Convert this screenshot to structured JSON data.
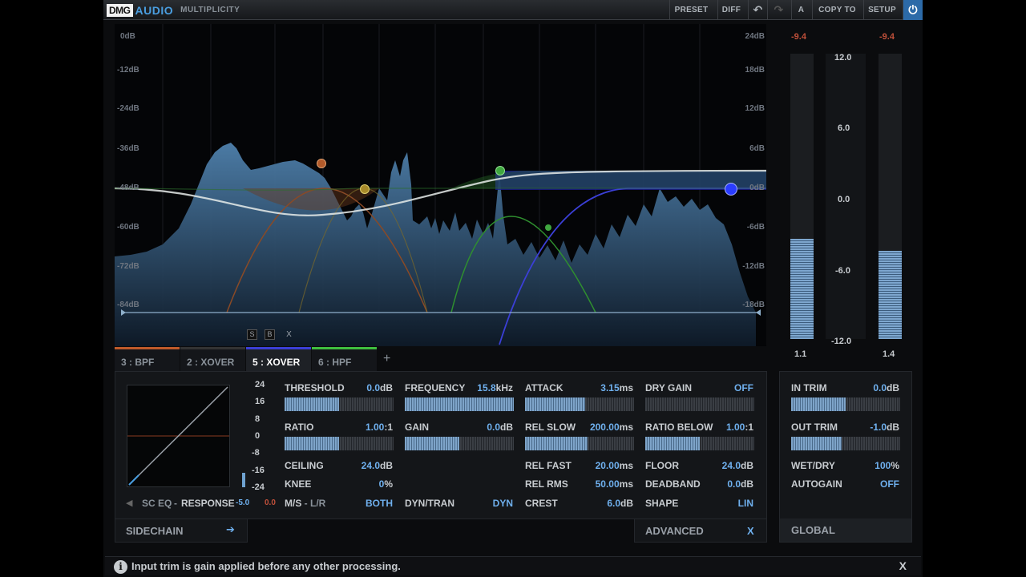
{
  "header": {
    "brand": "DMG",
    "brand2": "AUDIO",
    "product": "MULTIPLICITY",
    "buttons": {
      "preset": "PRESET",
      "diff": "DIFF",
      "ab": "A",
      "copy_to": "COPY TO",
      "setup": "SETUP"
    }
  },
  "graph": {
    "left_scale": [
      "0dB",
      "-12dB",
      "-24dB",
      "-36dB",
      "-48dB",
      "-60dB",
      "-72dB",
      "-84dB"
    ],
    "right_scale": [
      "24dB",
      "18dB",
      "12dB",
      "6dB",
      "0dB",
      "-6dB",
      "-12dB",
      "-18dB"
    ],
    "solo_buttons": [
      "S",
      "B",
      "X"
    ],
    "colors": {
      "band3": "#c05a2a",
      "band4": "#c9a43a",
      "band5": "#3fbf3f",
      "band6": "#3b3fd6",
      "spectrum": "#3d6a94"
    }
  },
  "meters": {
    "peak_left": "-9.4",
    "peak_right": "-9.4",
    "scale": [
      "12.0",
      "6.0",
      "0.0",
      "-6.0",
      "-12.0"
    ],
    "value_left": "1.1",
    "value_right": "1.4",
    "level_left": 0.35,
    "level_right": 0.31
  },
  "tabs": [
    {
      "label": "3 : BPF",
      "color": "#c05a2a"
    },
    {
      "label": "2 : XOVER",
      "color": "#555"
    },
    {
      "label": "5 : XOVER",
      "color": "#3b3fd6"
    },
    {
      "label": "6 : HPF",
      "color": "#3fbf3f"
    }
  ],
  "tab_add": "+",
  "transfer_scale": [
    "24",
    "16",
    "8",
    "0",
    "-8",
    "-16",
    "-24"
  ],
  "sidechain": {
    "sc_eq": "SC EQ",
    "dash": "-",
    "response": "RESPONSE",
    "response_val1": "-5.0",
    "response_val2": "0.0",
    "label": "SIDECHAIN"
  },
  "params": {
    "threshold": {
      "label": "THRESHOLD",
      "value": "0.0",
      "unit": "dB",
      "level": 0.5
    },
    "ratio": {
      "label": "RATIO",
      "value": "1.00",
      "unit": ":1",
      "level": 0.5
    },
    "ceiling": {
      "label": "CEILING",
      "value": "24.0",
      "unit": "dB"
    },
    "knee": {
      "label": "KNEE",
      "value": "0",
      "unit": "%"
    },
    "ms": {
      "label": "M/S",
      "label2": "L/R",
      "value": "BOTH"
    },
    "frequency": {
      "label": "FREQUENCY",
      "value": "15.8",
      "unit": "kHz",
      "level": 1.0
    },
    "gain": {
      "label": "GAIN",
      "value": "0.0",
      "unit": "dB",
      "level": 0.5
    },
    "dyntran": {
      "label": "DYN/TRAN",
      "value": "DYN"
    },
    "attack": {
      "label": "ATTACK",
      "value": "3.15",
      "unit": "ms",
      "level": 0.55
    },
    "rel_slow": {
      "label": "REL SLOW",
      "value": "200.00",
      "unit": "ms",
      "level": 0.57
    },
    "rel_fast": {
      "label": "REL FAST",
      "value": "20.00",
      "unit": "ms"
    },
    "rel_rms": {
      "label": "REL RMS",
      "value": "50.00",
      "unit": "ms"
    },
    "crest": {
      "label": "CREST",
      "value": "6.0",
      "unit": "dB"
    },
    "dry_gain": {
      "label": "DRY GAIN",
      "value": "OFF",
      "level": 0
    },
    "ratio_below": {
      "label": "RATIO BELOW",
      "value": "1.00",
      "unit": ":1",
      "level": 0.5
    },
    "floor": {
      "label": "FLOOR",
      "value": "24.0",
      "unit": "dB"
    },
    "deadband": {
      "label": "DEADBAND",
      "value": "0.0",
      "unit": "dB"
    },
    "shape": {
      "label": "SHAPE",
      "value": "LIN"
    }
  },
  "advanced": {
    "label": "ADVANCED",
    "close": "X"
  },
  "global": {
    "in_trim": {
      "label": "IN TRIM",
      "value": "0.0",
      "unit": "dB",
      "level": 0.5
    },
    "out_trim": {
      "label": "OUT TRIM",
      "value": "-1.0",
      "unit": "dB",
      "level": 0.46
    },
    "wet_dry": {
      "label": "WET/DRY",
      "value": "100",
      "unit": "%"
    },
    "autogain": {
      "label": "AUTOGAIN",
      "value": "OFF"
    },
    "label": "GLOBAL"
  },
  "status": {
    "message": "Input trim is gain applied before any other processing.",
    "close": "X"
  }
}
